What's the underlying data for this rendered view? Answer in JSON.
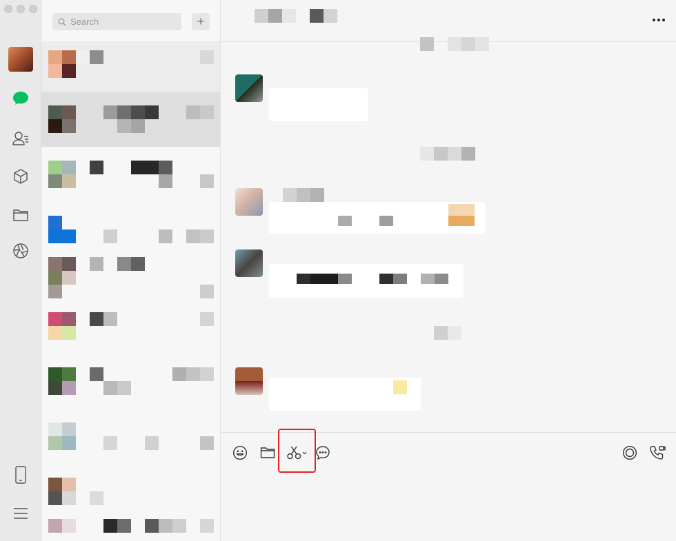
{
  "window": {
    "traffic_lights": [
      "close",
      "minimize",
      "zoom"
    ]
  },
  "sidebar": {
    "icons": [
      {
        "name": "chats-icon",
        "active": true,
        "color": "#07c160"
      },
      {
        "name": "contacts-icon"
      },
      {
        "name": "mini-programs-cube-icon"
      },
      {
        "name": "files-folder-icon"
      },
      {
        "name": "moments-aperture-icon"
      },
      {
        "name": "phone-device-icon"
      },
      {
        "name": "menu-icon"
      }
    ]
  },
  "chat_list": {
    "search_placeholder": "Search",
    "add_button": "+",
    "active_index": 1
  },
  "chat": {
    "more_button": "more-icon"
  },
  "toolbar": {
    "tools": [
      "emoji-icon",
      "folder-icon",
      "screenshot-scissors-icon",
      "chat-history-icon"
    ],
    "right_tools": [
      "live-icon",
      "call-icon"
    ],
    "highlighted_tool": "screenshot-scissors-icon",
    "highlight_color": "#e0232b"
  },
  "theme": {
    "accent": "#07c160",
    "bubble": "#ffffff",
    "background": "#f5f5f5"
  }
}
